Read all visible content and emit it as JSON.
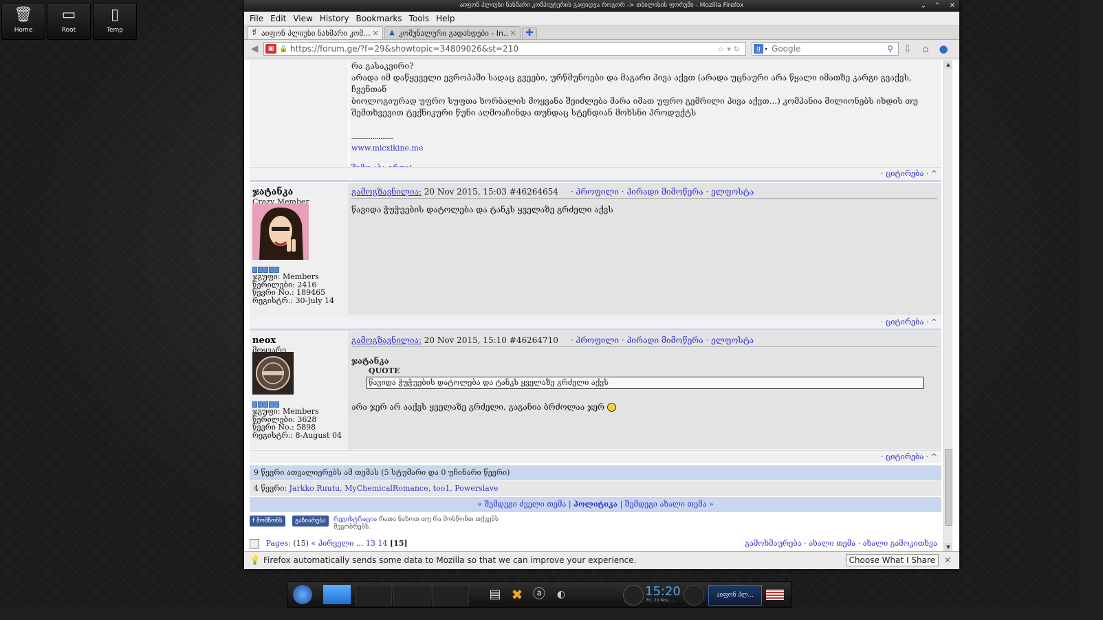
{
  "desktop_icons": [
    {
      "label": "Home",
      "icon": "trash-icon"
    },
    {
      "label": "Root",
      "icon": "drive-icon"
    },
    {
      "label": "Temp",
      "icon": "folder-icon"
    }
  ],
  "window": {
    "title": "აიფონ პლიუსი ნახმარი კომპიუტერის გაფიდვა როგორ -> თბილისის ფორუმი - Mozilla Firefox"
  },
  "menu": [
    "File",
    "Edit",
    "View",
    "History",
    "Bookmarks",
    "Tools",
    "Help"
  ],
  "tabs": [
    {
      "title": "აიფონ პლიუსი ნახმარი კომ...",
      "active": true
    },
    {
      "title": "კომუნალური გადახდები - In...",
      "active": false
    }
  ],
  "url": "https://forum.ge/?f=29&showtopic=34809026&st=210",
  "search_placeholder": "Google",
  "top_post": {
    "lines": [
      "რა გასაკვირი?",
      "არადა იმ დაწყეველი ევროპაში სადაც გვეები, ურწმუნოები და მაგარი პივა აქვთ (არადა უცნაური არა წყალი იმათზე კარგი გვაქვს, ჩვენთან",
      "ბიოლოგიურად უფრო სუფთა ხორბალის მოყვანა შეიძლება მარა იმათ უფრო გემრილი პივა აქვთ...) კომპანია მილიონებს იხდის თუ",
      "შემთხვევით ტექნიკური წუნი აღმოაჩინდა თუნდაც სტენდიან მოხსნი პროდუქტს"
    ],
    "sig_dashes": "--------------------",
    "sig_link": "www.micxikine.me",
    "sig_tag": "შემო აბა ერთი!"
  },
  "bar_links": "· ციტირება · ^",
  "posts": [
    {
      "username": "ჯატანკა",
      "user_title": "Crazy Member",
      "posted_label": "გამოგზავნილია:",
      "date": "20 Nov 2015, 15:03",
      "post_id": "#46264654",
      "actions": "· პროფილი · პირადი მიმოწერა · ელფოსტა",
      "text": "წავიდა ჭუჭუების დატოლება და ტანკს ყველაზე გრძელი აქვს",
      "stats": [
        "ჯგუფი: Members",
        "წერილები: 2416",
        "წევრი No.: 189465",
        "რეგისტრ.: 30-July 14"
      ]
    },
    {
      "username": "neox",
      "user_title": "მოყვარე",
      "posted_label": "გამოგზავნილია:",
      "date": "20 Nov 2015, 15:10",
      "post_id": "#46264710",
      "actions": "· პროფილი · პირადი მიმოწერა · ელფოსტა",
      "quote_author": "ჯატანკა",
      "quote_label": "QUOTE",
      "quote_text": "წავიდა ჭუჭუების დატოლება და ტანკს ყველაზე გრძელი აქვს",
      "text": "არა ჯერ არ ააქვს ყველაზე გრძელი, გაგანია ბრძოლაა ჯერ",
      "stats": [
        "ჯგუფი: Members",
        "წერილები: 3628",
        "წევრი No.: 5898",
        "რეგისტრ.: 8-August 04"
      ]
    }
  ],
  "online_line": "9 წევრი ათვალიერებს ამ თემას (5 სტუმარი და 0 უჩინარი წევრი)",
  "members_prefix": "4 წევრი:",
  "members": "Jarkko Ruutu, MyChemicalRomance, too1, Powerslave",
  "topic_nav": {
    "prev": "« შემდეგი ძველი თემა",
    "section": "პოლიტიკა",
    "next": "შემდეგი ახალი თემა »"
  },
  "fb": {
    "like": "მომწონს",
    "share": "გაზიარება",
    "register_link": "რეგისტრაცია",
    "register_text": "რათა ნახოთ თუ რა მოსწონთ თქვენს",
    "register_text2": "მეგობრებს."
  },
  "pages": {
    "label": "Pages:",
    "count": "(15)",
    "first": "« პირველი",
    "dots": "...",
    "p13": "13",
    "p14": "14",
    "current": "[15]"
  },
  "bottom_actions": "გამოხმაურება · ახალი თემა · ახალი გამოკითხვა",
  "notification": {
    "text": "Firefox automatically sends some data to Mozilla so that we can improve your experience.",
    "button": "Choose What I Share"
  },
  "taskbar": {
    "clock": "15:20",
    "date": "Fri, 20 Nov, ...",
    "active_task": "აიფონ პლ..."
  }
}
